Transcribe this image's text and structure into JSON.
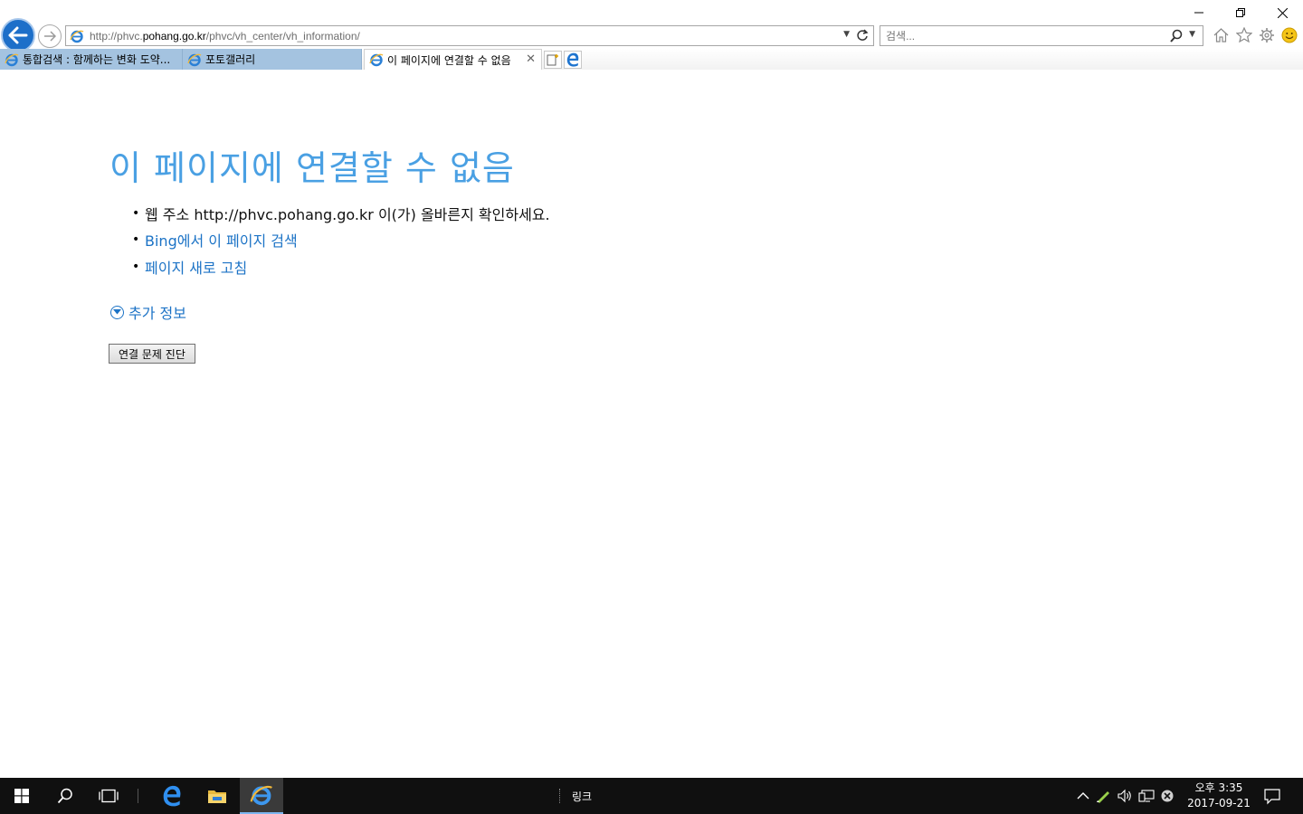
{
  "browser": {
    "url_prefix": "http://phvc.",
    "url_domain": "pohang.go.kr",
    "url_path": "/phvc/vh_center/vh_information/",
    "search_placeholder": "검색..."
  },
  "tabs": [
    {
      "label": "통합검색 : 함께하는 변화 도약...",
      "active": false
    },
    {
      "label": "포토갤러리",
      "active": false
    },
    {
      "label": "이 페이지에 연결할 수 없음",
      "active": true
    }
  ],
  "page": {
    "title": "이 페이지에 연결할 수 없음",
    "suggestion_1": "웹 주소 http://phvc.pohang.go.kr 이(가) 올바른지 확인하세요.",
    "suggestion_2": "Bing에서 이 페이지 검색",
    "suggestion_3": "페이지 새로 고침",
    "more_info": "추가 정보",
    "diagnose_button": "연결 문제 진단"
  },
  "taskbar": {
    "links_label": "링크",
    "clock_time": "오후 3:35",
    "clock_date": "2017-09-21"
  },
  "colors": {
    "title_blue": "#4aa0e3",
    "link_blue": "#1c73c6",
    "inactive_tab": "#a4c3e0",
    "taskbar": "#101010"
  }
}
